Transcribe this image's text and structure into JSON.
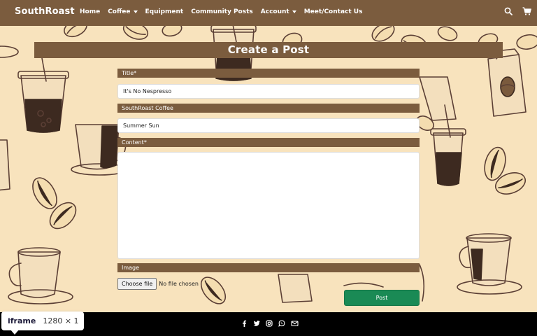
{
  "navbar": {
    "brand": "SouthRoast",
    "links": [
      {
        "label": "Home",
        "dropdown": false
      },
      {
        "label": "Coffee",
        "dropdown": true
      },
      {
        "label": "Equipment",
        "dropdown": false
      },
      {
        "label": "Community Posts",
        "dropdown": false
      },
      {
        "label": "Account",
        "dropdown": true
      },
      {
        "label": "Meet/Contact Us",
        "dropdown": false
      }
    ],
    "icons": [
      "search-icon",
      "cart-icon"
    ]
  },
  "page": {
    "title": "Create a Post"
  },
  "form": {
    "title_label": "Title*",
    "title_value": "It's No Nespresso",
    "coffee_label": "SouthRoast Coffee",
    "coffee_value": "Summer Sun",
    "content_label": "Content*",
    "content_value": "",
    "image_label": "Image",
    "file_button_label": "Choose file",
    "file_status": "No file chosen",
    "submit_label": "Post"
  },
  "footer": {
    "icons": [
      "facebook-icon",
      "twitter-icon",
      "instagram-icon",
      "whatsapp-icon",
      "email-icon"
    ]
  },
  "devtools": {
    "tag": "iframe",
    "size": "1280 × 1"
  },
  "colors": {
    "background": "#f8e3bd",
    "brand_brown": "#7b5c3e",
    "post_green": "#1a8a55",
    "footer": "#000000"
  }
}
